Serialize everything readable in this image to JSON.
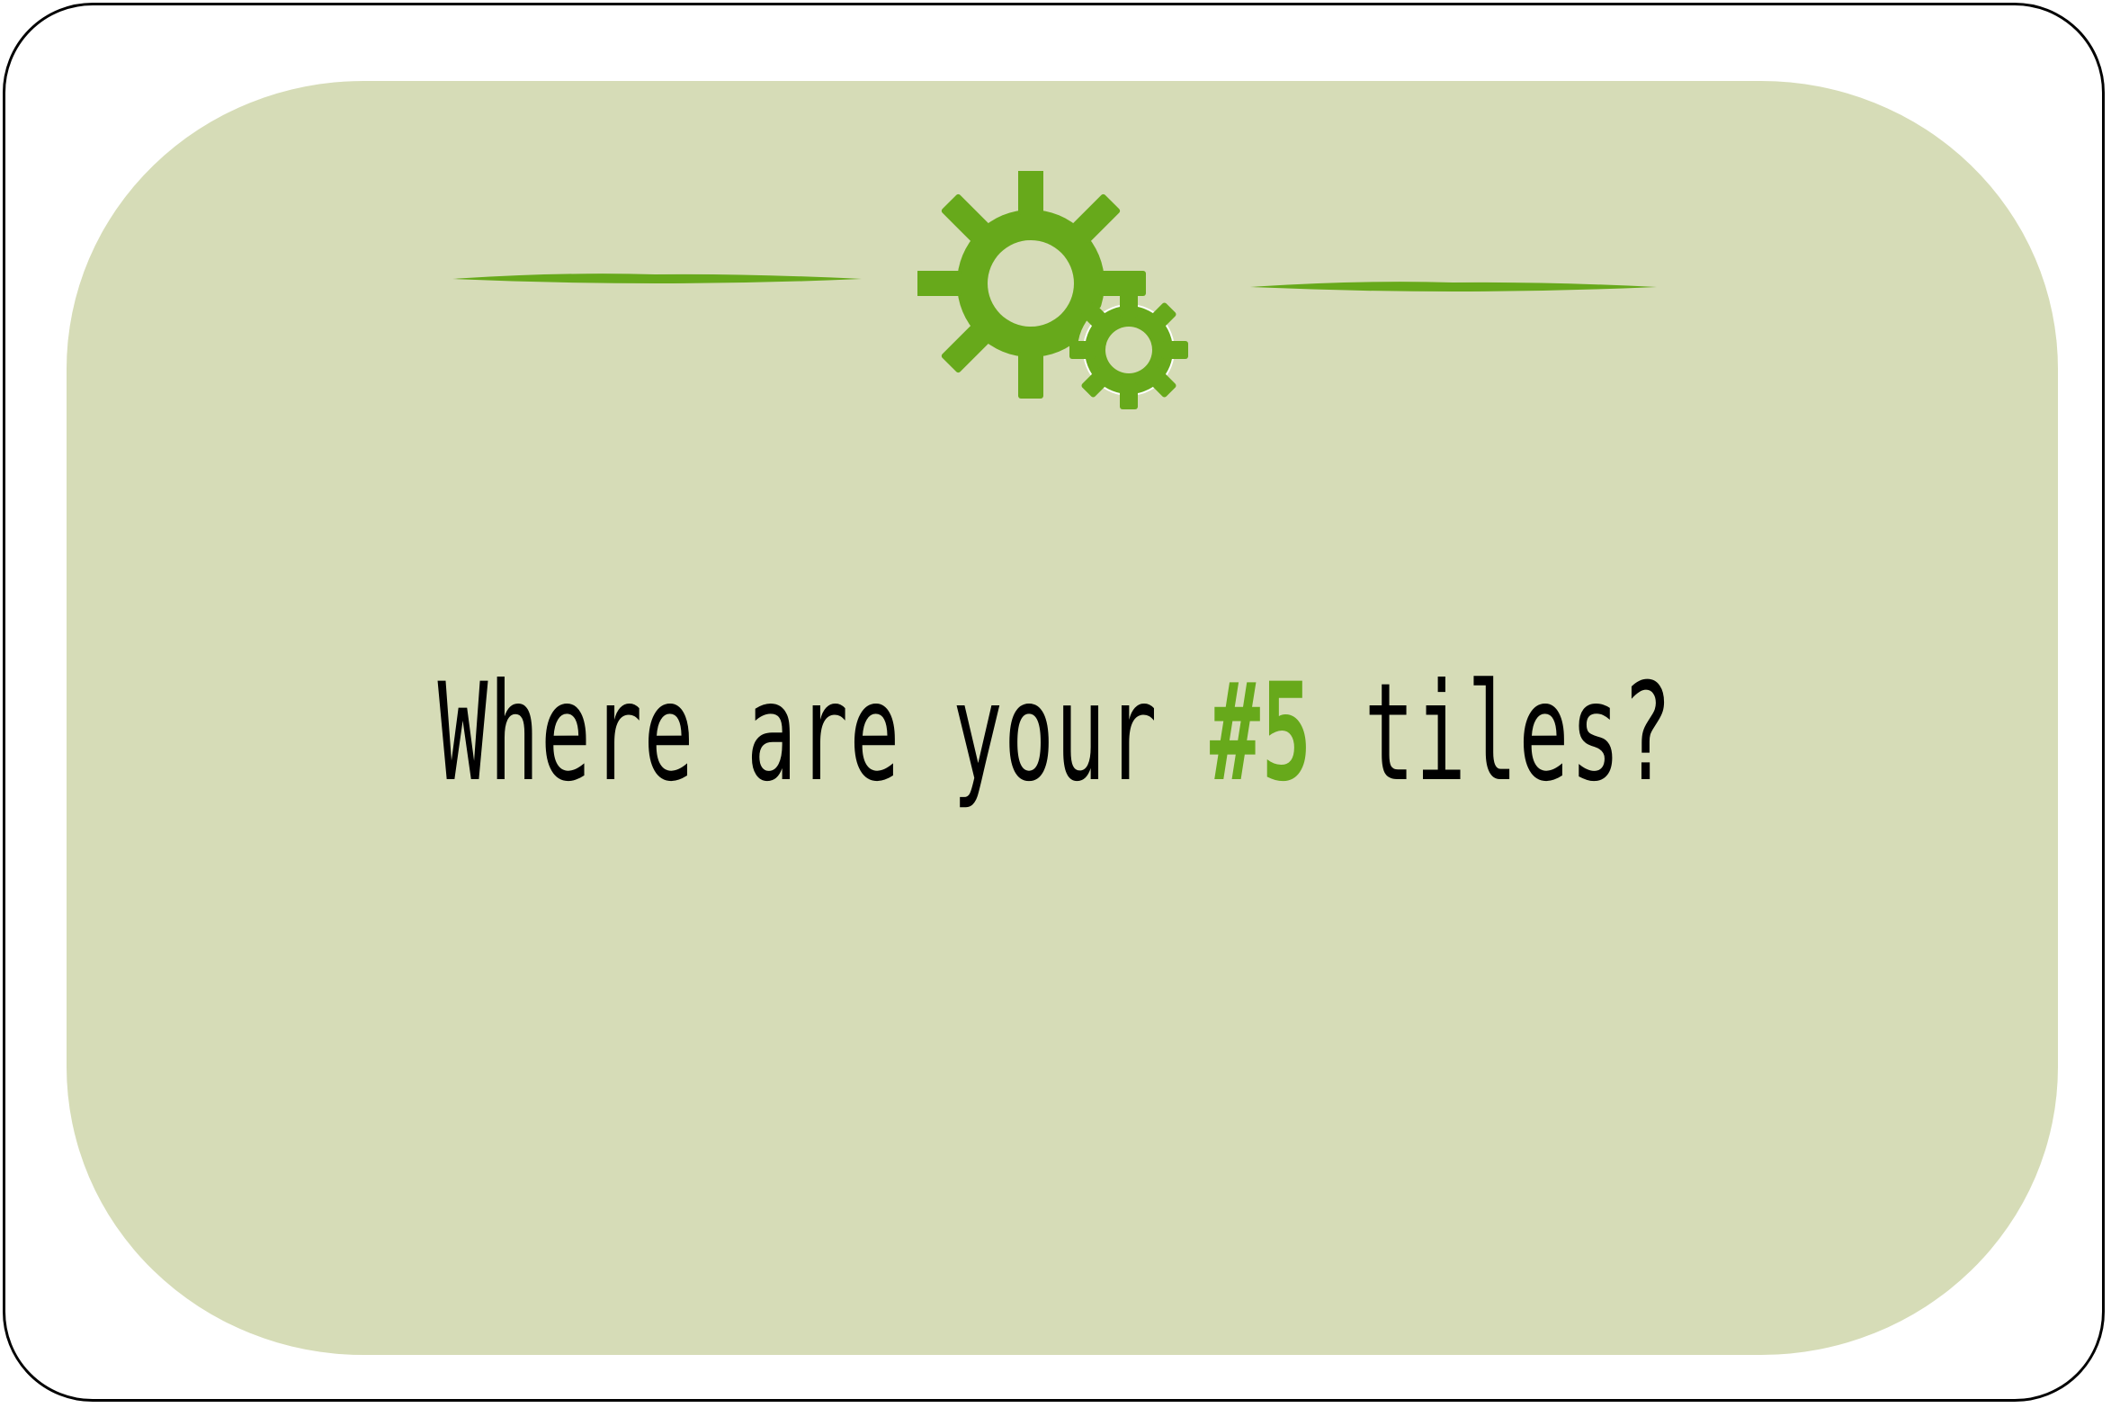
{
  "question": {
    "prefix": "Where are your ",
    "highlight": "#5",
    "suffix": " tiles?"
  },
  "icons": {
    "header_icon": "gears-icon"
  },
  "colors": {
    "accent": "#67a91b",
    "panel_background": "#d6dcb7",
    "card_border": "#000000",
    "text": "#000000"
  }
}
